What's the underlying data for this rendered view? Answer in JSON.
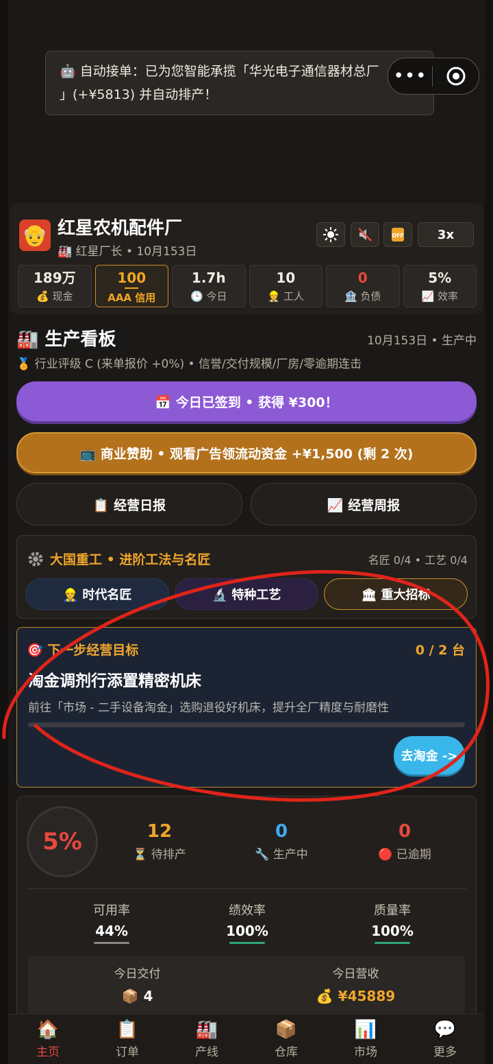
{
  "toast": {
    "line1": "🤖 自动接单：已为您智能承揽「华光电子通信器材总厂",
    "line2": "」(+¥5813) 并自动排产！"
  },
  "capsule": {
    "more": "•••"
  },
  "factory": {
    "logo": "👴",
    "name": "红星农机配件厂",
    "subtitle": "🏭 红星厂长 • 10月153日",
    "speed": "3x",
    "toolbar_icons": [
      "sun-icon",
      "mute-icon",
      "off-icon"
    ],
    "stats": [
      {
        "value": "189万",
        "label": "💰 现金"
      },
      {
        "value": "100",
        "label": "AAA 信用"
      },
      {
        "value": "1.7h",
        "label": "🕒 今日"
      },
      {
        "value": "10",
        "label": "👷 工人"
      },
      {
        "value": "0",
        "label": "🏦 负债"
      },
      {
        "value": "5%",
        "label": "📈 效率"
      }
    ]
  },
  "board": {
    "title": "🏭 生产看板",
    "meta": "10月153日 • 生产中",
    "rank": "🏅 行业评级 C (来单报价 +0%) • 信誉/交付规模/厂房/零逾期连击"
  },
  "signin": "📅 今日已签到 • 获得 ¥300！",
  "sponsor": "📺 商业赞助 • 观看广告领流动资金 +¥1,500 (剩 2 次)",
  "reports": {
    "daily": "📋 经营日报",
    "weekly": "📈 经营周报"
  },
  "heavy": {
    "title": "大国重工 • 进阶工法与名匠",
    "meta": "名匠 0/4 • 工艺 0/4",
    "tabs": [
      "👷 时代名匠",
      "🔬 特种工艺",
      "🏛 重大招标"
    ]
  },
  "goal": {
    "title": "🎯 下一步经营目标",
    "count": "0 / 2 台",
    "headline": "淘金调剂行添置精密机床",
    "desc": "前往「市场 - 二手设备淘金」选购退役好机床，提升全厂精度与耐磨性",
    "progress": 0.0,
    "button": "去淘金 ->"
  },
  "production": {
    "efficiency": "5%",
    "stats": [
      {
        "value": "12",
        "label": "⏳ 待排产",
        "color": "#f0a62c"
      },
      {
        "value": "0",
        "label": "🔧 生产中",
        "color": "#3fa9f0"
      },
      {
        "value": "0",
        "label": "🔴 已逾期",
        "color": "#e4493f"
      }
    ],
    "oee": [
      {
        "label": "可用率",
        "value": "44%",
        "color": "#888888"
      },
      {
        "label": "绩效率",
        "value": "100%",
        "color": "#2fa67a"
      },
      {
        "label": "质量率",
        "value": "100%",
        "color": "#2fa67a"
      }
    ],
    "today": {
      "delivery_label": "今日交付",
      "delivery_value": "📦 4",
      "revenue_label": "今日营收",
      "revenue_value": "💰 ¥45889"
    }
  },
  "nav": [
    {
      "icon": "🏠",
      "label": "主页",
      "active": true
    },
    {
      "icon": "📋",
      "label": "订单"
    },
    {
      "icon": "🏭",
      "label": "产线"
    },
    {
      "icon": "📦",
      "label": "仓库"
    },
    {
      "icon": "📊",
      "label": "市场"
    },
    {
      "icon": "💬",
      "label": "更多"
    }
  ],
  "colors": {
    "accent": "#f0a62c",
    "danger": "#e4493f",
    "signin": "#8d5ad6",
    "sponsor": "#b3711c",
    "go": "#39b6ea",
    "annotation": "#e0241a"
  }
}
